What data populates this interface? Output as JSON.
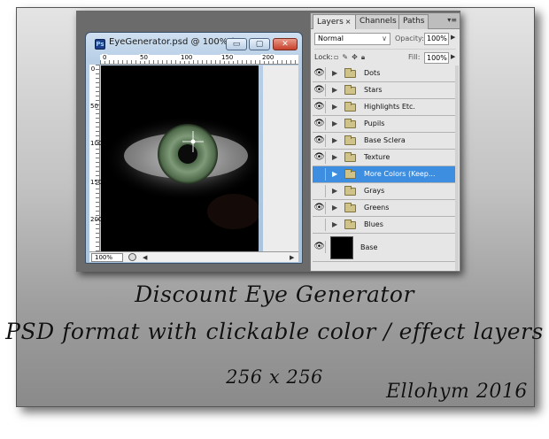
{
  "document_window": {
    "title": "EyeGenerator.psd @ 100% (...",
    "app_badge": "Ps",
    "buttons": {
      "minimize": "▭",
      "maximize": "▢",
      "close": "✕"
    },
    "ruler_top": [
      "0",
      "50",
      "100",
      "150",
      "200"
    ],
    "ruler_left": [
      "0",
      "50",
      "100",
      "150",
      "200"
    ],
    "zoom": "100%"
  },
  "layers_panel": {
    "tabs": [
      {
        "label": "Layers"
      },
      {
        "label": "Channels"
      },
      {
        "label": "Paths"
      }
    ],
    "tab_close": "×",
    "menu_glyph": "▾≡",
    "blend_mode": "Normal",
    "opacity_label": "Opacity:",
    "opacity_value": "100%",
    "lock_label": "Lock:",
    "fill_label": "Fill:",
    "fill_value": "100%",
    "layers": [
      {
        "name": "Dots",
        "visible": true,
        "selected": false
      },
      {
        "name": "Stars",
        "visible": true,
        "selected": false
      },
      {
        "name": "Highlights Etc.",
        "visible": true,
        "selected": false
      },
      {
        "name": "Pupils",
        "visible": true,
        "selected": false
      },
      {
        "name": "Base Sclera",
        "visible": true,
        "selected": false
      },
      {
        "name": "Texture",
        "visible": true,
        "selected": false
      },
      {
        "name": "More Colors (Keep...",
        "visible": false,
        "selected": true
      },
      {
        "name": "Grays",
        "visible": false,
        "selected": false
      },
      {
        "name": "Greens",
        "visible": true,
        "selected": false
      },
      {
        "name": "Blues",
        "visible": false,
        "selected": false
      }
    ],
    "base_layer": {
      "name": "Base",
      "visible": true
    }
  },
  "caption": {
    "line1": "Discount Eye Generator",
    "line2": "PSD format with clickable color / effect layers",
    "line3": "256 x 256",
    "signature": "Ellohym 2016"
  },
  "colors": {
    "selection": "#3d8ee0",
    "iris": "#7f9a78",
    "canvas": "#000000"
  }
}
